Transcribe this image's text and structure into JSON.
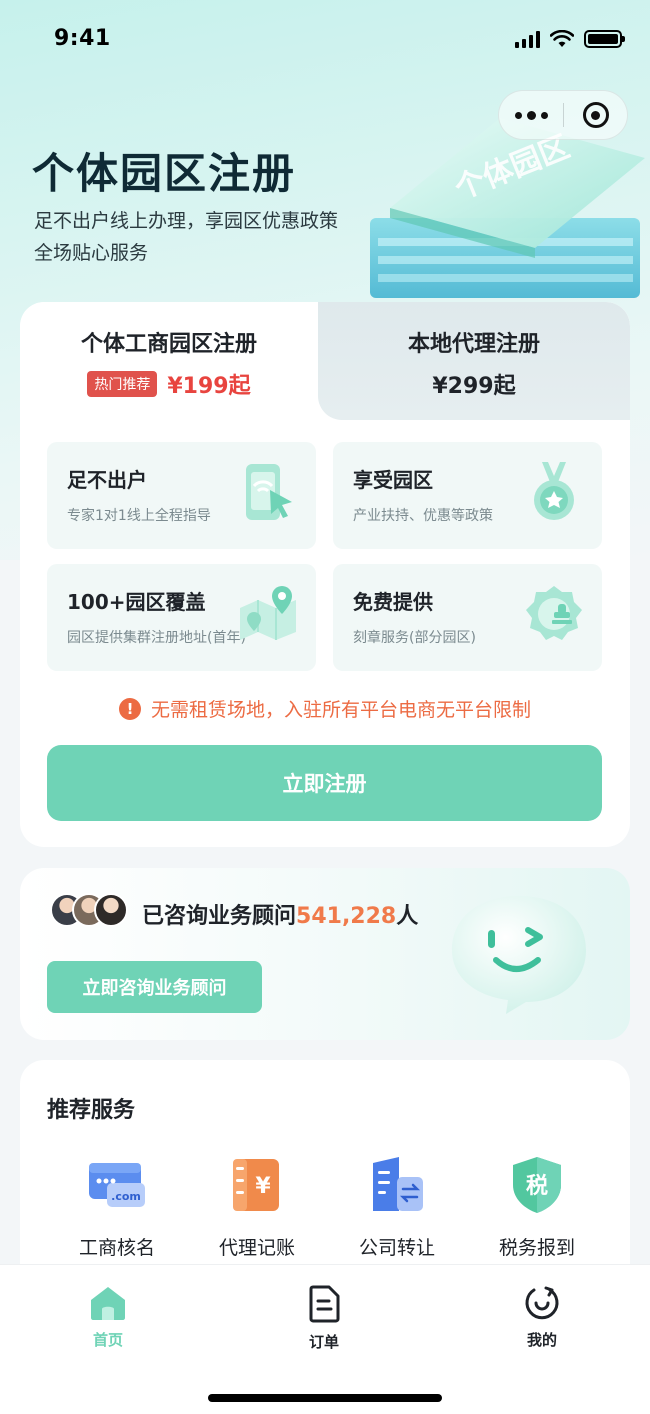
{
  "status_bar": {
    "time": "9:41"
  },
  "hero": {
    "title": "个体园区注册",
    "subtitle_line1": "足不出户线上办理，享园区优惠政策",
    "subtitle_line2": "全场贴心服务",
    "illustration_text": "个体园区"
  },
  "tabs": [
    {
      "title": "个体工商园区注册",
      "badge": "热门推荐",
      "price": "¥199起",
      "active": true
    },
    {
      "title": "本地代理注册",
      "price": "¥299起",
      "active": false
    }
  ],
  "features": [
    {
      "title": "足不出户",
      "desc": "专家1对1线上全程指导",
      "icon": "phone-cursor-icon"
    },
    {
      "title": "享受园区",
      "desc": "产业扶持、优惠等政策",
      "icon": "medal-icon"
    },
    {
      "title": "100+园区覆盖",
      "desc": "园区提供集群注册地址(首年)",
      "icon": "map-pin-icon"
    },
    {
      "title": "免费提供",
      "desc": "刻章服务(部分园区)",
      "icon": "seal-icon"
    }
  ],
  "notice": {
    "icon": "!",
    "text": "无需租赁场地，入驻所有平台电商无平台限制"
  },
  "register_button": "立即注册",
  "consult": {
    "prefix": "已咨询业务顾问",
    "count": "541,228",
    "suffix": "人",
    "button": "立即咨询业务顾问"
  },
  "recommend": {
    "title": "推荐服务",
    "items": [
      {
        "label": "工商核名",
        "icon": "domain-card-icon",
        "icon_text": ".com"
      },
      {
        "label": "代理记账",
        "icon": "ledger-icon",
        "icon_text": "¥"
      },
      {
        "label": "公司转让",
        "icon": "building-transfer-icon"
      },
      {
        "label": "税务报到",
        "icon": "tax-shield-icon",
        "icon_text": "税"
      }
    ]
  },
  "tabbar": [
    {
      "label": "首页",
      "icon": "home-icon",
      "active": true
    },
    {
      "label": "订单",
      "icon": "order-icon",
      "active": false
    },
    {
      "label": "我的",
      "icon": "profile-icon",
      "active": false
    }
  ],
  "colors": {
    "accent": "#6fd3b6",
    "price_red": "#e8443f",
    "notice_orange": "#ec6b43",
    "count_orange": "#f07a4a"
  }
}
